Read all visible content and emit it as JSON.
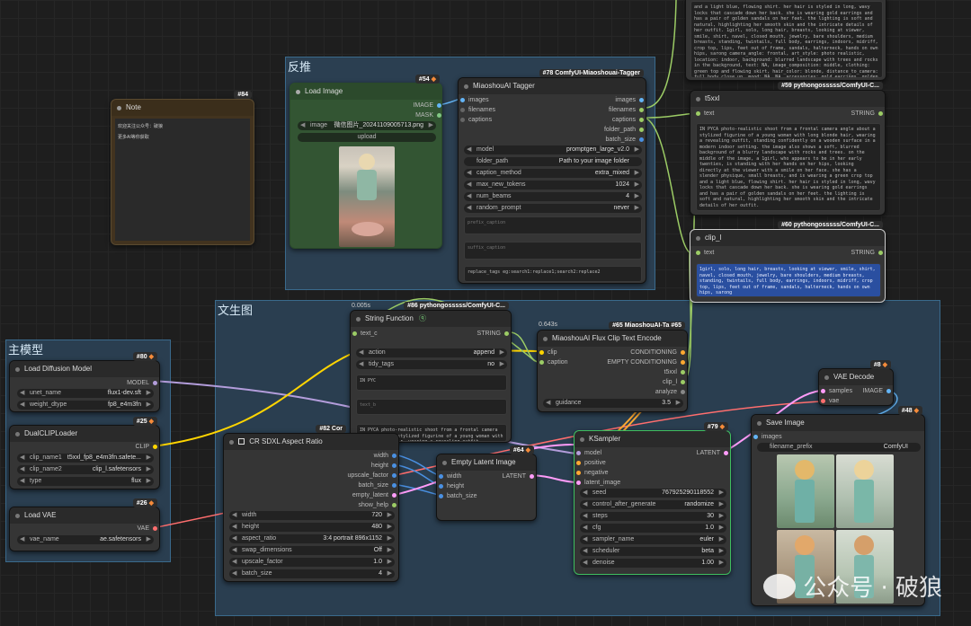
{
  "groups": {
    "fantui": "反推",
    "wenshengtu": "文生图",
    "zhumoxing": "主模型"
  },
  "note": {
    "title": "Note",
    "badge": "#84",
    "line1": "欢迎关注公众号：破狼",
    "line2": "更多AI等你获取"
  },
  "load_image": {
    "title": "Load Image",
    "badge": "#54",
    "out_image": "IMAGE",
    "out_mask": "MASK",
    "image_key": "image",
    "image_value": "微信图片_20241109005713.png",
    "upload": "upload"
  },
  "tagger": {
    "title": "MiaoshouAI Tagger",
    "badge": "#78 ComfyUI-Miaoshouai-Tagger",
    "in_images": "images",
    "in_filenames": "filenames",
    "in_captions": "captions",
    "out_images": "images",
    "out_filenames": "filenames",
    "out_captions": "captions",
    "out_folder_path": "folder_path",
    "out_batch_size": "batch_size",
    "widgets": [
      {
        "k": "model",
        "v": "promptgen_large_v2.0"
      },
      {
        "k": "folder_path",
        "v": "Path to your image folder"
      },
      {
        "k": "caption_method",
        "v": "extra_mixed"
      },
      {
        "k": "max_new_tokens",
        "v": "1024"
      },
      {
        "k": "num_beams",
        "v": "4"
      },
      {
        "k": "random_prompt",
        "v": "never"
      }
    ],
    "prefix_caption": "prefix_caption",
    "suffix_caption": "suffix_caption",
    "replace_tags": "replace_tags eg:search1:replace1;search2:replace2"
  },
  "top_text": {
    "text": "and a light blue, flowing shirt. her hair is styled in long, wavy locks that cascade down her back. she is wearing gold earrings and has a pair of golden sandals on her feet. the lighting is soft and natural, highlighting her smooth skin and the intricate details of her outfit.\n\n1girl, solo, long hair, breasts, looking at viewer, smile, shirt, navel, closed mouth, jewelry, bare shoulders, medium breasts, standing, twintails, full body, earrings, indoors, midriff, crop top, lips, feet out of frame, sandals, halterneck, hands on own hips, sarong\n\ncamera_angle: frontal, art_style: photo realistic, location: indoor, background: blurred landscape with trees and rocks in the background, text: NA, image_composition: middle, clothing: green top and flowing skirt, hair_color: blonde, distance_to_camera: full body close up, mood: NA, NA, accessories: gold earrings, golden sandals"
  },
  "t5xxl": {
    "title": "t5xxl",
    "badge": "#59 pythongosssss/ComfyUI-C...",
    "in": "text",
    "out": "STRING",
    "text": "IN PYCA photo-realistic shoot from a frontal camera angle about a stylized figurine of a young woman with long blonde hair, wearing a revealing outfit, standing confidently on a wooden surface in a modern indoor setting. the image also shows a soft, blurred background of a blurry landscape with rocks and trees. on the middle of the image, a 1girl, who appears to be in her early twenties, is standing with her hands on her hips, looking directly at the viewer with a smile on her face. she has a slender physique, small breasts, and is wearing a green crop top and a light blue, flowing shirt. her hair is styled in long, wavy locks that cascade down her back. she is wearing gold earrings and has a pair of golden sandals on her feet. the lighting is soft and natural, highlighting her smooth skin and the intricate details of her outfit."
  },
  "clip_l": {
    "title": "clip_l",
    "badge": "#60 pythongosssss/ComfyUI-C...",
    "in": "text",
    "out": "STRING",
    "text": "1girl, solo, long hair, breasts, looking at viewer, smile, shirt, navel, closed mouth, jewelry, bare shoulders, medium breasts, standing, twintails, full body, earrings, indoors, midriff, crop top, lips, feet out of frame, sandals, halterneck, hands on own hips, sarong"
  },
  "string_function": {
    "title": "String Function",
    "badge": "#86 pythongosssss/ComfyUI-C...",
    "timing": "0.005s",
    "in": "text_c",
    "out": "STRING",
    "action_k": "action",
    "action_v": "append",
    "tidy_k": "tidy_tags",
    "tidy_v": "no",
    "text_a": "IN PYC",
    "text_b": "text_b",
    "preview": "IN PYCA photo-realistic shoot from a frontal camera angle about a stylized figurine of a young woman with long blonde hair, wearing a revealing outfit, standing"
  },
  "flux_clip": {
    "title": "MiaoshouAI Flux Clip Text Encode",
    "badge": "#65 MiaoshouAI-Ta",
    "badge2": "#65",
    "timing": "0.643s",
    "in_clip": "clip",
    "in_caption": "caption",
    "out_cond": "CONDITIONING",
    "out_empty": "EMPTY CONDITIONING",
    "out_t5": "t5xxl",
    "out_clip_l": "clip_l",
    "out_analyze": "analyze",
    "guidance_k": "guidance",
    "guidance_v": "3.5"
  },
  "load_diffusion": {
    "title": "Load Diffusion Model",
    "badge": "#80",
    "out": "MODEL",
    "w1k": "unet_name",
    "w1v": "flux1-dev.sft",
    "w2k": "weight_dtype",
    "w2v": "fp8_e4m3fn"
  },
  "dual_clip": {
    "title": "DualCLIPLoader",
    "badge": "#25",
    "out": "CLIP",
    "w1k": "clip_name1",
    "w1v": "t5xxl_fp8_e4m3fn.safete...",
    "w2k": "clip_name2",
    "w2v": "clip_l.safetensors",
    "w3k": "type",
    "w3v": "flux"
  },
  "load_vae": {
    "title": "Load VAE",
    "badge": "#26",
    "out": "VAE",
    "w1k": "vae_name",
    "w1v": "ae.safetensors"
  },
  "aspect": {
    "title": "CR SDXL Aspect Ratio",
    "badge": "#82 Cor",
    "out_width": "width",
    "out_height": "height",
    "out_upscale": "upscale_factor",
    "out_batch": "batch_size",
    "out_empty": "empty_latent",
    "out_help": "show_help",
    "widgets": [
      {
        "k": "width",
        "v": "720"
      },
      {
        "k": "height",
        "v": "480"
      },
      {
        "k": "aspect_ratio",
        "v": "3:4 portrait 896x1152"
      },
      {
        "k": "swap_dimensions",
        "v": "Off"
      },
      {
        "k": "upscale_factor",
        "v": "1.0"
      },
      {
        "k": "batch_size",
        "v": "4"
      }
    ]
  },
  "empty_latent": {
    "title": "Empty Latent Image",
    "badge": "#64",
    "in_width": "width",
    "in_height": "height",
    "in_batch": "batch_size",
    "out": "LATENT"
  },
  "ksampler": {
    "title": "KSampler",
    "badge": "#79",
    "in_model": "model",
    "in_positive": "positive",
    "in_negative": "negative",
    "in_latent": "latent_image",
    "out": "LATENT",
    "widgets": [
      {
        "k": "seed",
        "v": "767925290118552"
      },
      {
        "k": "control_after_generate",
        "v": "randomize"
      },
      {
        "k": "steps",
        "v": "30"
      },
      {
        "k": "cfg",
        "v": "1.0"
      },
      {
        "k": "sampler_name",
        "v": "euler"
      },
      {
        "k": "scheduler",
        "v": "beta"
      },
      {
        "k": "denoise",
        "v": "1.00"
      }
    ]
  },
  "vae_decode": {
    "title": "VAE Decode",
    "badge": "#8",
    "in_samples": "samples",
    "in_vae": "vae",
    "out": "IMAGE"
  },
  "save_image": {
    "title": "Save Image",
    "badge": "#48",
    "in": "images",
    "prefix_k": "filename_prefix",
    "prefix_v": "ComfyUI"
  },
  "watermark": "公众号 · 破狼",
  "colors": {
    "image": "#64b5f6",
    "mask": "#81c784",
    "string": "#9ccc65",
    "model": "#b39ddb",
    "clip": "#ffd500",
    "vae": "#ff6e6e",
    "latent": "#ff9cf9",
    "conditioning": "#ffa931",
    "int": "#4a90e2",
    "group_fill": "#2a3e50"
  }
}
